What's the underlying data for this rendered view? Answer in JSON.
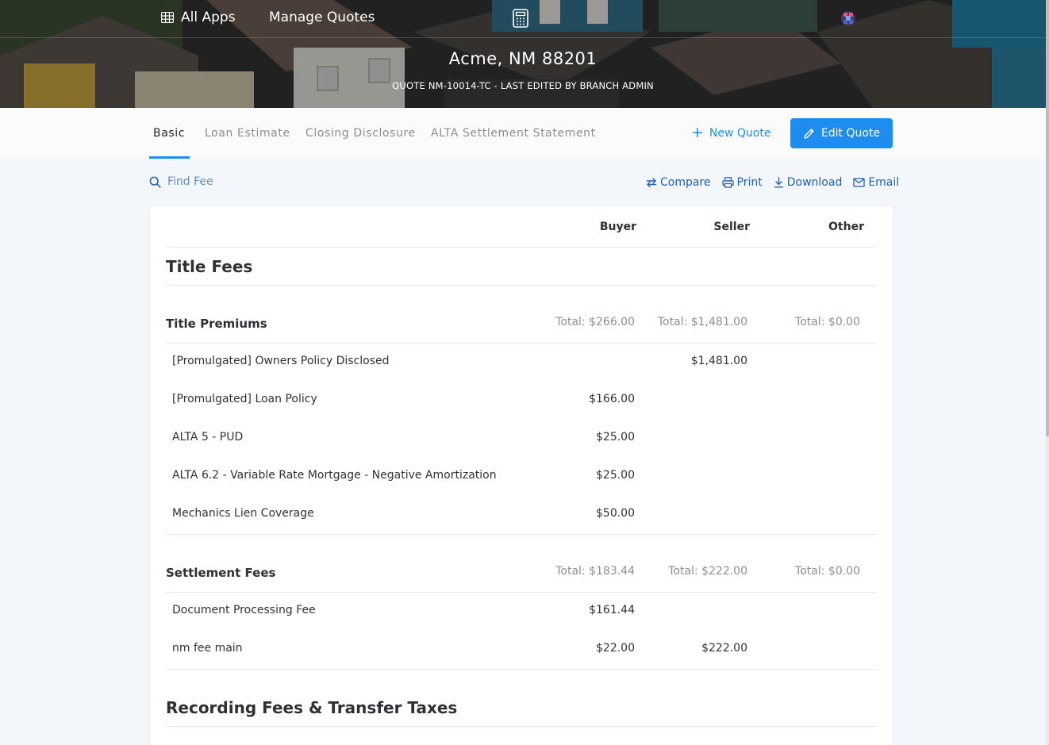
{
  "topbar": {
    "all_apps": "All Apps",
    "manage_quotes": "Manage Quotes"
  },
  "hero": {
    "title": "Acme, NM 88201",
    "subtitle": "QUOTE NM-10014-TC - LAST EDITED BY BRANCH ADMIN"
  },
  "tabs": [
    {
      "label": "Basic"
    },
    {
      "label": "Loan Estimate"
    },
    {
      "label": "Closing Disclosure"
    },
    {
      "label": "ALTA Settlement Statement"
    }
  ],
  "actions": {
    "new_quote": "New Quote",
    "edit_quote": "Edit Quote"
  },
  "toolbar": {
    "find_fee": "Find Fee",
    "compare": "Compare",
    "print": "Print",
    "download": "Download",
    "email": "Email"
  },
  "table": {
    "columns": [
      "Buyer",
      "Seller",
      "Other"
    ],
    "sections": [
      {
        "title": "Title Fees",
        "groups": [
          {
            "title": "Title Premiums",
            "totals": [
              "Total:  $266.00",
              "Total:  $1,481.00",
              "Total:  $0.00"
            ],
            "rows": [
              {
                "label": "[Promulgated] Owners Policy Disclosed",
                "buyer": "",
                "seller": "$1,481.00",
                "other": ""
              },
              {
                "label": "[Promulgated] Loan Policy",
                "buyer": "$166.00",
                "seller": "",
                "other": ""
              },
              {
                "label": "ALTA 5 - PUD",
                "buyer": "$25.00",
                "seller": "",
                "other": ""
              },
              {
                "label": "ALTA 6.2 - Variable Rate Mortgage - Negative Amortization",
                "buyer": "$25.00",
                "seller": "",
                "other": ""
              },
              {
                "label": "Mechanics Lien Coverage",
                "buyer": "$50.00",
                "seller": "",
                "other": ""
              }
            ]
          },
          {
            "title": "Settlement Fees",
            "totals": [
              "Total:  $183.44",
              "Total:  $222.00",
              "Total:  $0.00"
            ],
            "rows": [
              {
                "label": "Document Processing Fee",
                "buyer": "$161.44",
                "seller": "",
                "other": ""
              },
              {
                "label": "nm fee main",
                "buyer": "$22.00",
                "seller": "$222.00",
                "other": ""
              }
            ]
          }
        ]
      },
      {
        "title": "Recording Fees & Transfer Taxes",
        "groups": []
      }
    ]
  },
  "colors": {
    "accent": "#1f8ded",
    "link": "#1f5fb5",
    "muted_text": "#8a8e95"
  }
}
